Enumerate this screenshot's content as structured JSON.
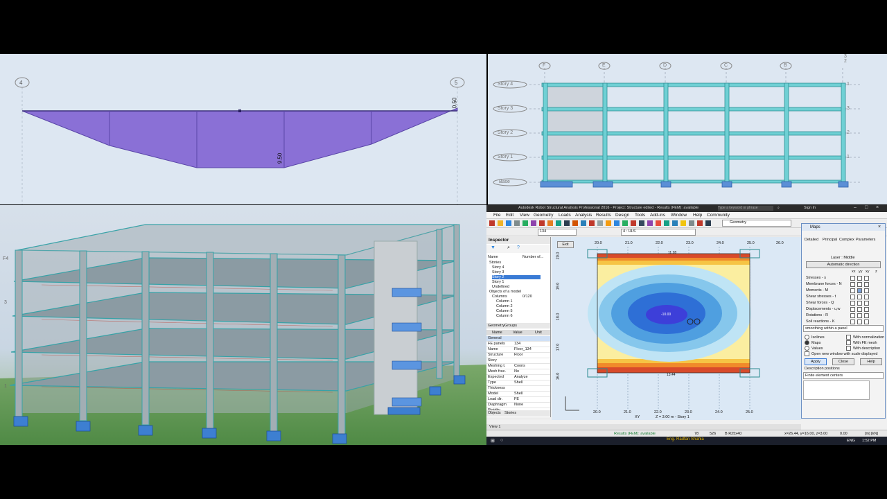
{
  "diagram": {
    "node_left": "4",
    "node_right": "5",
    "value_mid": "9.50",
    "value_end": "0.50",
    "fill_color": "#8a70d6"
  },
  "elevation": {
    "axes": [
      "F",
      "E",
      "D",
      "C",
      "B"
    ],
    "stories": [
      "Story 4",
      "Story 3",
      "Story 2",
      "Story 1"
    ],
    "base": "Base",
    "right_tags": [
      "1",
      "1",
      "3",
      "2",
      "1",
      "1"
    ],
    "top_tags": [
      "3",
      "2",
      "1"
    ]
  },
  "model3d": {
    "sidebar_labels": [
      "F4",
      "3",
      "1"
    ]
  },
  "robot": {
    "window_title": "Autodesk Robot Structural Analysis Professional 2016 - Project: Structure edited - Results (FEM): available",
    "search_placeholder": "Type a keyword or phrase",
    "sign_in": "Sign In",
    "menu": [
      "File",
      "Edit",
      "View",
      "Geometry",
      "Loads",
      "Analysis",
      "Results",
      "Design",
      "Tools",
      "Add-ins",
      "Window",
      "Help",
      "Community"
    ],
    "toolbar_dd_left": "134",
    "toolbar_dd_case": "4 : ULS",
    "toolbar_dd_layout": "Geometry",
    "inspector": {
      "title": "Inspector",
      "col_name": "Name",
      "col_number": "Number of...",
      "tree": [
        "Stories",
        "Story 4",
        "Story 3",
        "Story 2",
        "Story 1",
        "Undefined",
        "Objects of a model",
        "Columns",
        "Column 1",
        "Column 2",
        "Column 5",
        "Column 6"
      ],
      "columns_count": "0/120",
      "tabs": [
        "Geometry",
        "Groups"
      ],
      "prop_headers": [
        "Name",
        "Value",
        "Unit"
      ],
      "props": [
        [
          "General",
          ""
        ],
        [
          "FE panels",
          "134"
        ],
        [
          "Name",
          "Floor_134"
        ],
        [
          "Structure",
          "Floor"
        ],
        [
          "Story",
          ""
        ],
        [
          "Meshing t.",
          "Coons"
        ],
        [
          "Mesh free.",
          "No"
        ],
        [
          "Expected",
          "Analyze"
        ],
        [
          "Type",
          "Shell"
        ],
        [
          "Thickness",
          ""
        ],
        [
          "Model",
          "Shell"
        ],
        [
          "Load dir.",
          "FE"
        ],
        [
          "Diaphragm",
          "None"
        ],
        [
          "Rigidity",
          ""
        ],
        [
          "Label",
          ""
        ]
      ],
      "bottom_tabs": [
        "Objects",
        "Stories"
      ],
      "view_tab": "View 1"
    },
    "map": {
      "exit_btn": "Exit",
      "top_ticks": [
        "20.0",
        "21.0",
        "22.0",
        "23.0",
        "24.0",
        "25.0",
        "26.0"
      ],
      "left_ticks": [
        "20.0",
        "19.0",
        "18.0",
        "17.0",
        "16.0"
      ],
      "bottom_ticks": [
        "20.0",
        "21.0",
        "22.0",
        "23.0",
        "24.0",
        "25.0"
      ],
      "top_value": "11.28",
      "bottom_value": "13.44",
      "min_value": "-10.00",
      "view_label": "Z = 3.00 m - Story 1",
      "xy_label": "XY"
    },
    "maps_dialog": {
      "title": "Maps",
      "tabs": [
        "Detailed",
        "Principal",
        "Complex",
        "Parameters"
      ],
      "layer": "Layer : Middle",
      "auto_dir": "Automatic direction",
      "col_heads": [
        "xx",
        "yy",
        "xy",
        "z"
      ],
      "rows": [
        "Stresses - s",
        "Membrane forces - N",
        "Moments - M",
        "Shear stresses - t",
        "Shear forces - Q",
        "Displacements - u,w",
        "Rotations - R",
        "Soil reactions - K"
      ],
      "smoothing": "smoothing within a panel",
      "opt_isolines": "Isolines",
      "opt_maps": "Maps",
      "opt_values": "Values",
      "opt_norm": "With normalization",
      "opt_fe": "With FE mesh",
      "opt_desc": "With description",
      "open_new": "Open new window with scale displayed",
      "desc_pos": "Description positions",
      "desc_val": "Finite element centers",
      "apply": "Apply",
      "close": "Close",
      "help": "Help"
    },
    "status": {
      "results": "Results (FEM): available",
      "n1": "78",
      "n2": "526",
      "section": "B R25x40",
      "coords": "x=26.44, y=16.00, z=3.00",
      "val": "0.00",
      "units": "[m] [kN]",
      "lang": "ENG",
      "time": "1:52 PM",
      "watermark": "Eng. Radfan Shahla"
    }
  },
  "colors": {
    "bg": "#000000",
    "pane_bg": "#dde7f2",
    "frame": "#5fc3c9",
    "accent_blue": "#3a7bd5"
  }
}
